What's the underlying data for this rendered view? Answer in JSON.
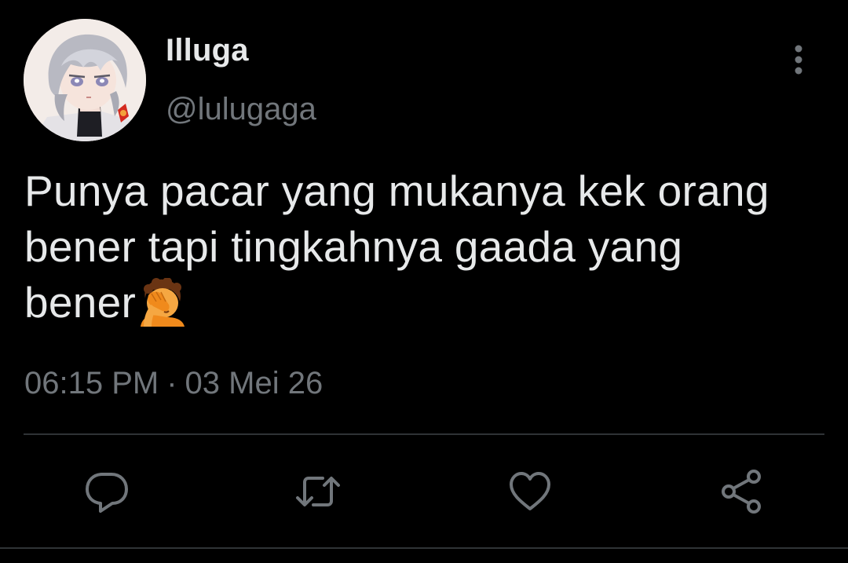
{
  "author": {
    "display_name": "Illuga",
    "handle": "@lulugaga"
  },
  "tweet": {
    "text_line1": "Punya pacar yang mukanya kek orang",
    "text_line2": "bener tapi tingkahnya gaada yang",
    "text_line3": "bener",
    "emoji": "facepalm-emoji",
    "time": "06:15 PM",
    "separator": "·",
    "date": "03 Mei 26"
  },
  "actions": {
    "reply_icon": "reply-icon",
    "retweet_icon": "retweet-icon",
    "like_icon": "heart-icon",
    "share_icon": "share-icon"
  },
  "colors": {
    "background": "#000000",
    "primary_text": "#e7e9ea",
    "secondary_text": "#71767b",
    "divider": "#2f3336"
  }
}
